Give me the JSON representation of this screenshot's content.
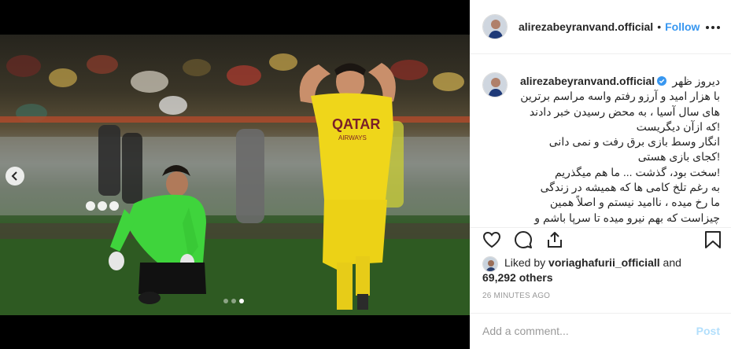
{
  "colors": {
    "accent": "#3897f0",
    "post_disabled": "#b2dffc",
    "text": "#262626",
    "muted": "#999999",
    "border": "#efefef"
  },
  "header": {
    "username": "alirezabeyranvand.official",
    "separator": "•",
    "follow_label": "Follow",
    "more_icon": "more-horizontal-icon"
  },
  "media": {
    "carousel": {
      "total": 3,
      "active_index": 3
    },
    "nav_icon": "chevron-left-icon"
  },
  "caption": {
    "username": "alirezabeyranvand.official",
    "verified": true,
    "lines": [
      "دیروز ظهر",
      "با هزار امید و آرزو رفتم واسه مراسم برترین",
      "های سال آسیا ، به محض رسیدن خبر دادند",
      "!که ازآن دیگریست",
      "انگار وسط بازی برق رفت و نمی دانی",
      "!کجای بازی هستی",
      "!سخت بود، گذشت ... ما هم میگذریم",
      "به رغم تلخ کامی ها که همیشه در زندگی",
      "ما رخ میده ، ناامید نیستم و اصلاً همین",
      "چیزاست که بهم نیرو میده تا سرپا باشم و"
    ]
  },
  "actions": {
    "like_icon": "heart-icon",
    "comment_icon": "comment-icon",
    "share_icon": "share-icon",
    "save_icon": "bookmark-icon"
  },
  "likes": {
    "prefix": "Liked by ",
    "username": "voriaghafurii_officiall",
    "conjunction": " and",
    "others": "69,292 others"
  },
  "timestamp": "26 MINUTES AGO",
  "add_comment": {
    "placeholder": "Add a comment...",
    "post_label": "Post"
  }
}
